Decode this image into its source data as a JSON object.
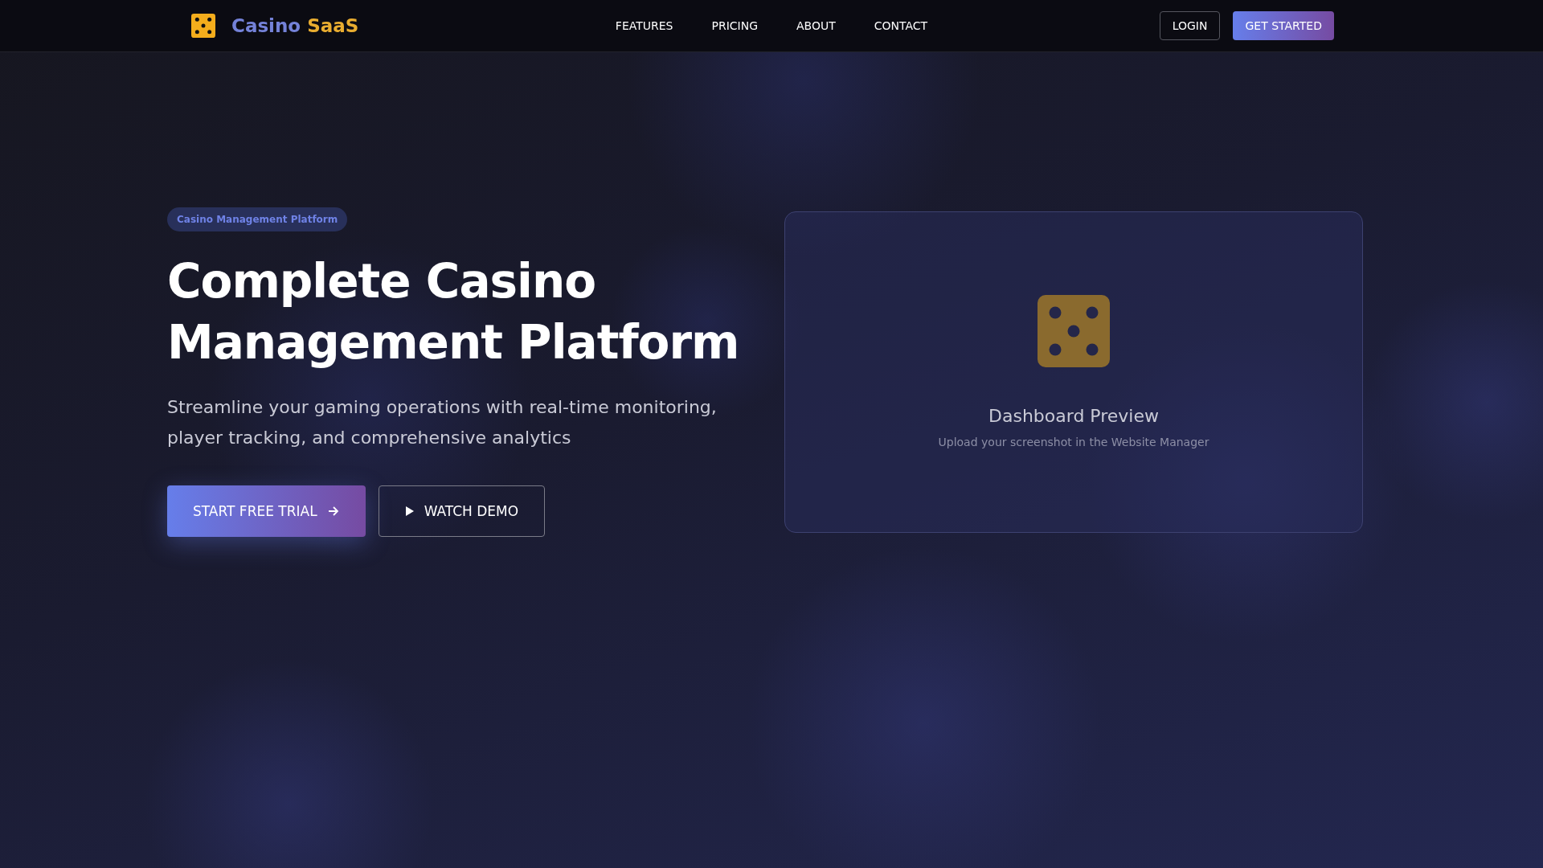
{
  "header": {
    "brand": {
      "first": "Casino",
      "second": "SaaS"
    },
    "nav": [
      {
        "label": "FEATURES"
      },
      {
        "label": "PRICING"
      },
      {
        "label": "ABOUT"
      },
      {
        "label": "CONTACT"
      }
    ],
    "actions": [
      {
        "label": "LOGIN",
        "kind": "outline"
      },
      {
        "label": "GET STARTED",
        "kind": "primary"
      }
    ]
  },
  "hero": {
    "badge": "Casino Management Platform",
    "title": "Complete Casino Management Platform",
    "subtitle": "Streamline your gaming operations with real-time monitoring, player tracking, and comprehensive analytics",
    "buttons": [
      {
        "label": "START FREE TRIAL",
        "kind": "primary"
      },
      {
        "label": "WATCH DEMO",
        "kind": "outline"
      }
    ]
  },
  "preview": {
    "title": "Dashboard Preview",
    "caption": "Upload your screenshot in the Website Manager"
  }
}
